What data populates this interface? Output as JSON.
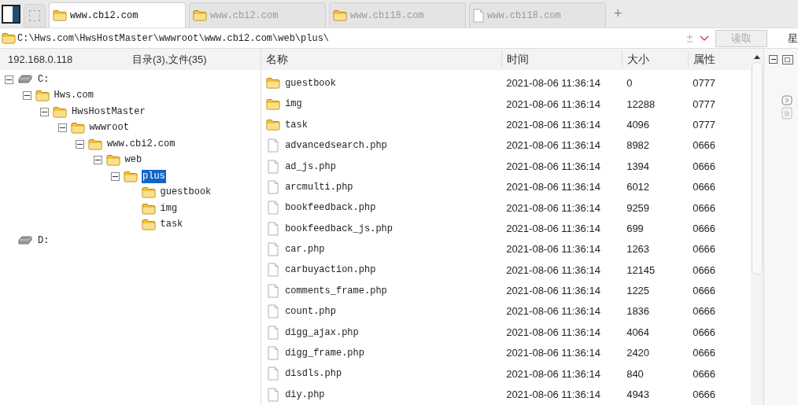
{
  "tabs": [
    {
      "label": "www.cbi2.com",
      "kind": "folder",
      "selected": true
    },
    {
      "label": "www.cbi2.com",
      "kind": "folder",
      "selected": false
    },
    {
      "label": "www.cbi18.com",
      "kind": "folder",
      "selected": false
    },
    {
      "label": "www.cbi18.com",
      "kind": "file",
      "selected": false
    }
  ],
  "new_tab": "+",
  "path_bar": {
    "value": "C:\\Hws.com\\HwsHostMaster\\wwwroot\\www.cbi2.com\\web\\plus\\",
    "read_button": "读取",
    "right_label": "星"
  },
  "left_pane": {
    "host": "192.168.0.118",
    "summary": "目录(3),文件(35)",
    "tree": [
      {
        "label": "C:",
        "kind": "drive",
        "expanded": true,
        "selected": false,
        "children": [
          {
            "label": "Hws.com",
            "kind": "folder",
            "expanded": true,
            "selected": false,
            "children": [
              {
                "label": "HwsHostMaster",
                "kind": "folder",
                "expanded": true,
                "selected": false,
                "children": [
                  {
                    "label": "wwwroot",
                    "kind": "folder",
                    "expanded": true,
                    "selected": false,
                    "children": [
                      {
                        "label": "www.cbi2.com",
                        "kind": "folder",
                        "expanded": true,
                        "selected": false,
                        "children": [
                          {
                            "label": "web",
                            "kind": "folder",
                            "expanded": true,
                            "selected": false,
                            "children": [
                              {
                                "label": "plus",
                                "kind": "folder",
                                "expanded": true,
                                "selected": true,
                                "children": [
                                  {
                                    "label": "guestbook",
                                    "kind": "folder",
                                    "selected": false
                                  },
                                  {
                                    "label": "img",
                                    "kind": "folder",
                                    "selected": false
                                  },
                                  {
                                    "label": "task",
                                    "kind": "folder",
                                    "selected": false
                                  }
                                ]
                              }
                            ]
                          }
                        ]
                      }
                    ]
                  }
                ]
              }
            ]
          }
        ]
      },
      {
        "label": "D:",
        "kind": "drive",
        "selected": false
      }
    ]
  },
  "file_table": {
    "columns": [
      "名称",
      "时间",
      "大小",
      "属性"
    ],
    "rows": [
      {
        "kind": "folder",
        "name": "guestbook",
        "time": "2021-08-06 11:36:14",
        "size": "0",
        "attr": "0777"
      },
      {
        "kind": "folder",
        "name": "img",
        "time": "2021-08-06 11:36:14",
        "size": "12288",
        "attr": "0777"
      },
      {
        "kind": "folder",
        "name": "task",
        "time": "2021-08-06 11:36:14",
        "size": "4096",
        "attr": "0777"
      },
      {
        "kind": "file",
        "name": "advancedsearch.php",
        "time": "2021-08-06 11:36:14",
        "size": "8982",
        "attr": "0666"
      },
      {
        "kind": "file",
        "name": "ad_js.php",
        "time": "2021-08-06 11:36:14",
        "size": "1394",
        "attr": "0666"
      },
      {
        "kind": "file",
        "name": "arcmulti.php",
        "time": "2021-08-06 11:36:14",
        "size": "6012",
        "attr": "0666"
      },
      {
        "kind": "file",
        "name": "bookfeedback.php",
        "time": "2021-08-06 11:36:14",
        "size": "9259",
        "attr": "0666"
      },
      {
        "kind": "file",
        "name": "bookfeedback_js.php",
        "time": "2021-08-06 11:36:14",
        "size": "699",
        "attr": "0666"
      },
      {
        "kind": "file",
        "name": "car.php",
        "time": "2021-08-06 11:36:14",
        "size": "1263",
        "attr": "0666"
      },
      {
        "kind": "file",
        "name": "carbuyaction.php",
        "time": "2021-08-06 11:36:14",
        "size": "12145",
        "attr": "0666"
      },
      {
        "kind": "file",
        "name": "comments_frame.php",
        "time": "2021-08-06 11:36:14",
        "size": "1225",
        "attr": "0666"
      },
      {
        "kind": "file",
        "name": "count.php",
        "time": "2021-08-06 11:36:14",
        "size": "1836",
        "attr": "0666"
      },
      {
        "kind": "file",
        "name": "digg_ajax.php",
        "time": "2021-08-06 11:36:14",
        "size": "4064",
        "attr": "0666"
      },
      {
        "kind": "file",
        "name": "digg_frame.php",
        "time": "2021-08-06 11:36:14",
        "size": "2420",
        "attr": "0666"
      },
      {
        "kind": "file",
        "name": "disdls.php",
        "time": "2021-08-06 11:36:14",
        "size": "840",
        "attr": "0666"
      },
      {
        "kind": "file",
        "name": "diy.php",
        "time": "2021-08-06 11:36:14",
        "size": "4943",
        "attr": "0666"
      }
    ]
  }
}
